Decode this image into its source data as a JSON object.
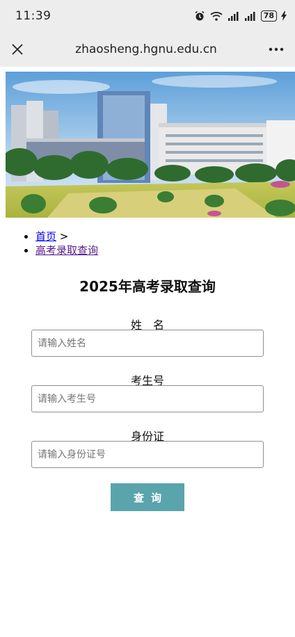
{
  "status": {
    "time": "11:39",
    "battery": "78"
  },
  "browser": {
    "url": "zhaosheng.hgnu.edu.cn"
  },
  "breadcrumb": {
    "home": "首页",
    "separator": ">",
    "current": "高考录取查询"
  },
  "page": {
    "title": "2025年高考录取查询"
  },
  "form": {
    "name_label": "姓　名",
    "name_placeholder": "请输入姓名",
    "exam_label": "考生号",
    "exam_placeholder": "请输入考生号",
    "id_label": "身份证",
    "id_placeholder": "请输入身份证号",
    "submit_label": "查询"
  },
  "colors": {
    "button": "#5aa4ab",
    "link": "#0000ee",
    "visited_link": "#551a8b"
  }
}
